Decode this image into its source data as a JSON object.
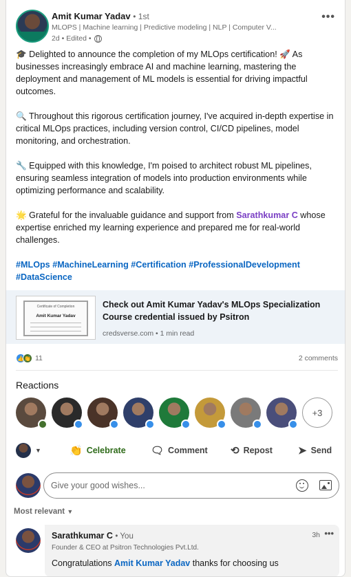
{
  "post": {
    "author": {
      "name": "Amit Kumar Yadav",
      "degree": "• 1st",
      "headline": "MLOPS | Machine learning | Predictive modeling | NLP | Computer V...",
      "meta": "2d • Edited •"
    },
    "paragraphs": [
      "🎓 Delighted to announce the completion of my MLOps certification! 🚀 As businesses increasingly embrace AI and machine learning, mastering the deployment and management of ML models is essential for driving impactful outcomes.",
      "🔍 Throughout this rigorous certification journey, I've acquired in-depth expertise in critical MLOps practices, including version control, CI/CD pipelines, model monitoring, and orchestration.",
      "🔧 Equipped with this knowledge, I'm poised to architect robust ML pipelines, ensuring seamless integration of models into production environments while optimizing performance and scalability."
    ],
    "gratitude_prefix": "🌟 Grateful for the invaluable guidance and support from ",
    "gratitude_mention": "Sarathkumar C",
    "gratitude_suffix": " whose expertise enriched my learning experience and prepared me for real-world challenges.",
    "hashtags": [
      "#MLOps",
      "#MachineLearning",
      "#Certification",
      "#ProfessionalDevelopment",
      "#DataScience"
    ]
  },
  "preview": {
    "thumb_heading": "Certificate of Completion",
    "thumb_name": "Amit Kumar Yadav",
    "title": "Check out Amit Kumar Yadav's MLOps Specialization Course credential issued by Psitron",
    "source": "credsverse.com • 1 min read"
  },
  "social": {
    "reaction_count": "11",
    "comments_count": "2 comments"
  },
  "reactions": {
    "title": "Reactions",
    "more": "+3",
    "faces": [
      {
        "bg": "#5a4a3e",
        "badge": "c"
      },
      {
        "bg": "#2a2a2a",
        "badge": "l"
      },
      {
        "bg": "#4a3328",
        "badge": "l"
      },
      {
        "bg": "#2f3f6a",
        "badge": "l"
      },
      {
        "bg": "#1f7a3a",
        "badge": "l"
      },
      {
        "bg": "#c49a3a",
        "badge": "l"
      },
      {
        "bg": "#7a7a7a",
        "badge": "l"
      },
      {
        "bg": "#4a4e7a",
        "badge": "l"
      }
    ]
  },
  "actions": {
    "celebrate": "Celebrate",
    "comment": "Comment",
    "repost": "Repost",
    "send": "Send"
  },
  "comment_box": {
    "placeholder": "Give your good wishes..."
  },
  "sort": {
    "label": "Most relevant"
  },
  "comment": {
    "name": "Sarathkumar C",
    "you": "• You",
    "time": "3h",
    "headline": "Founder & CEO at Psitron Technologies Pvt.Ltd.",
    "text_prefix": "Congratulations ",
    "mention": "Amit Kumar Yadav",
    "text_suffix": " thanks for choosing us"
  }
}
